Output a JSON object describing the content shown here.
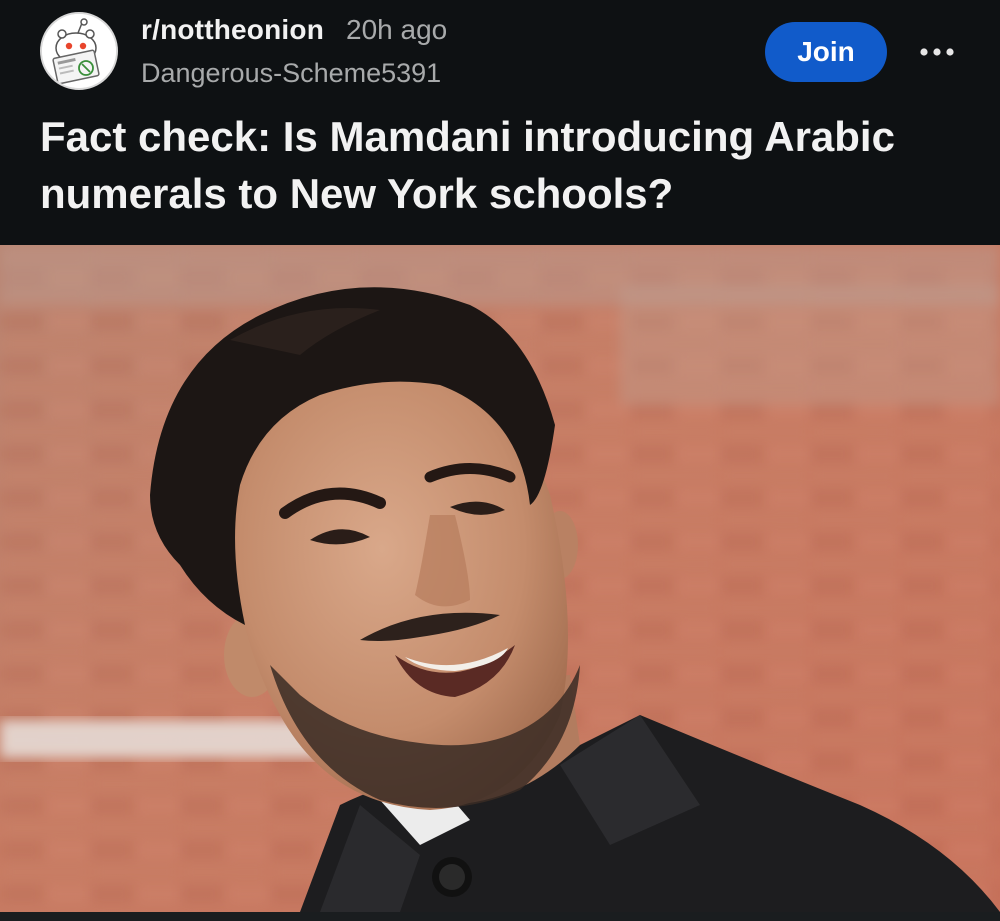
{
  "post": {
    "subreddit": "r/nottheonion",
    "time_ago": "20h ago",
    "author": "Dangerous-Scheme5391",
    "join_label": "Join",
    "title": "Fact check: Is Mamdani introducing Arabic numerals to New York schools?"
  },
  "icons": {
    "avatar": "subreddit-avatar-icon",
    "more": "more-options-icon"
  },
  "colors": {
    "background": "#0e1113",
    "join_button": "#115bca",
    "primary_text": "#f2f2f2",
    "secondary_text": "#a8aaab"
  }
}
